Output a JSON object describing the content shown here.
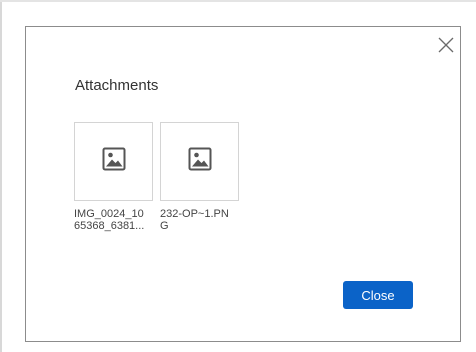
{
  "dialog": {
    "title": "Attachments",
    "close_icon": "close-icon",
    "attachments": [
      {
        "name_line1": "IMG_0024_10",
        "name_line2": "65368_6381...",
        "icon": "image-file-icon"
      },
      {
        "name_line1": "232-OP~1.PN",
        "name_line2": "G",
        "icon": "image-file-icon"
      }
    ],
    "close_button_label": "Close"
  },
  "colors": {
    "primary_button": "#0b63c8",
    "border": "#8c8c8c",
    "thumb_border": "#d4d4d4",
    "icon": "#555555"
  }
}
